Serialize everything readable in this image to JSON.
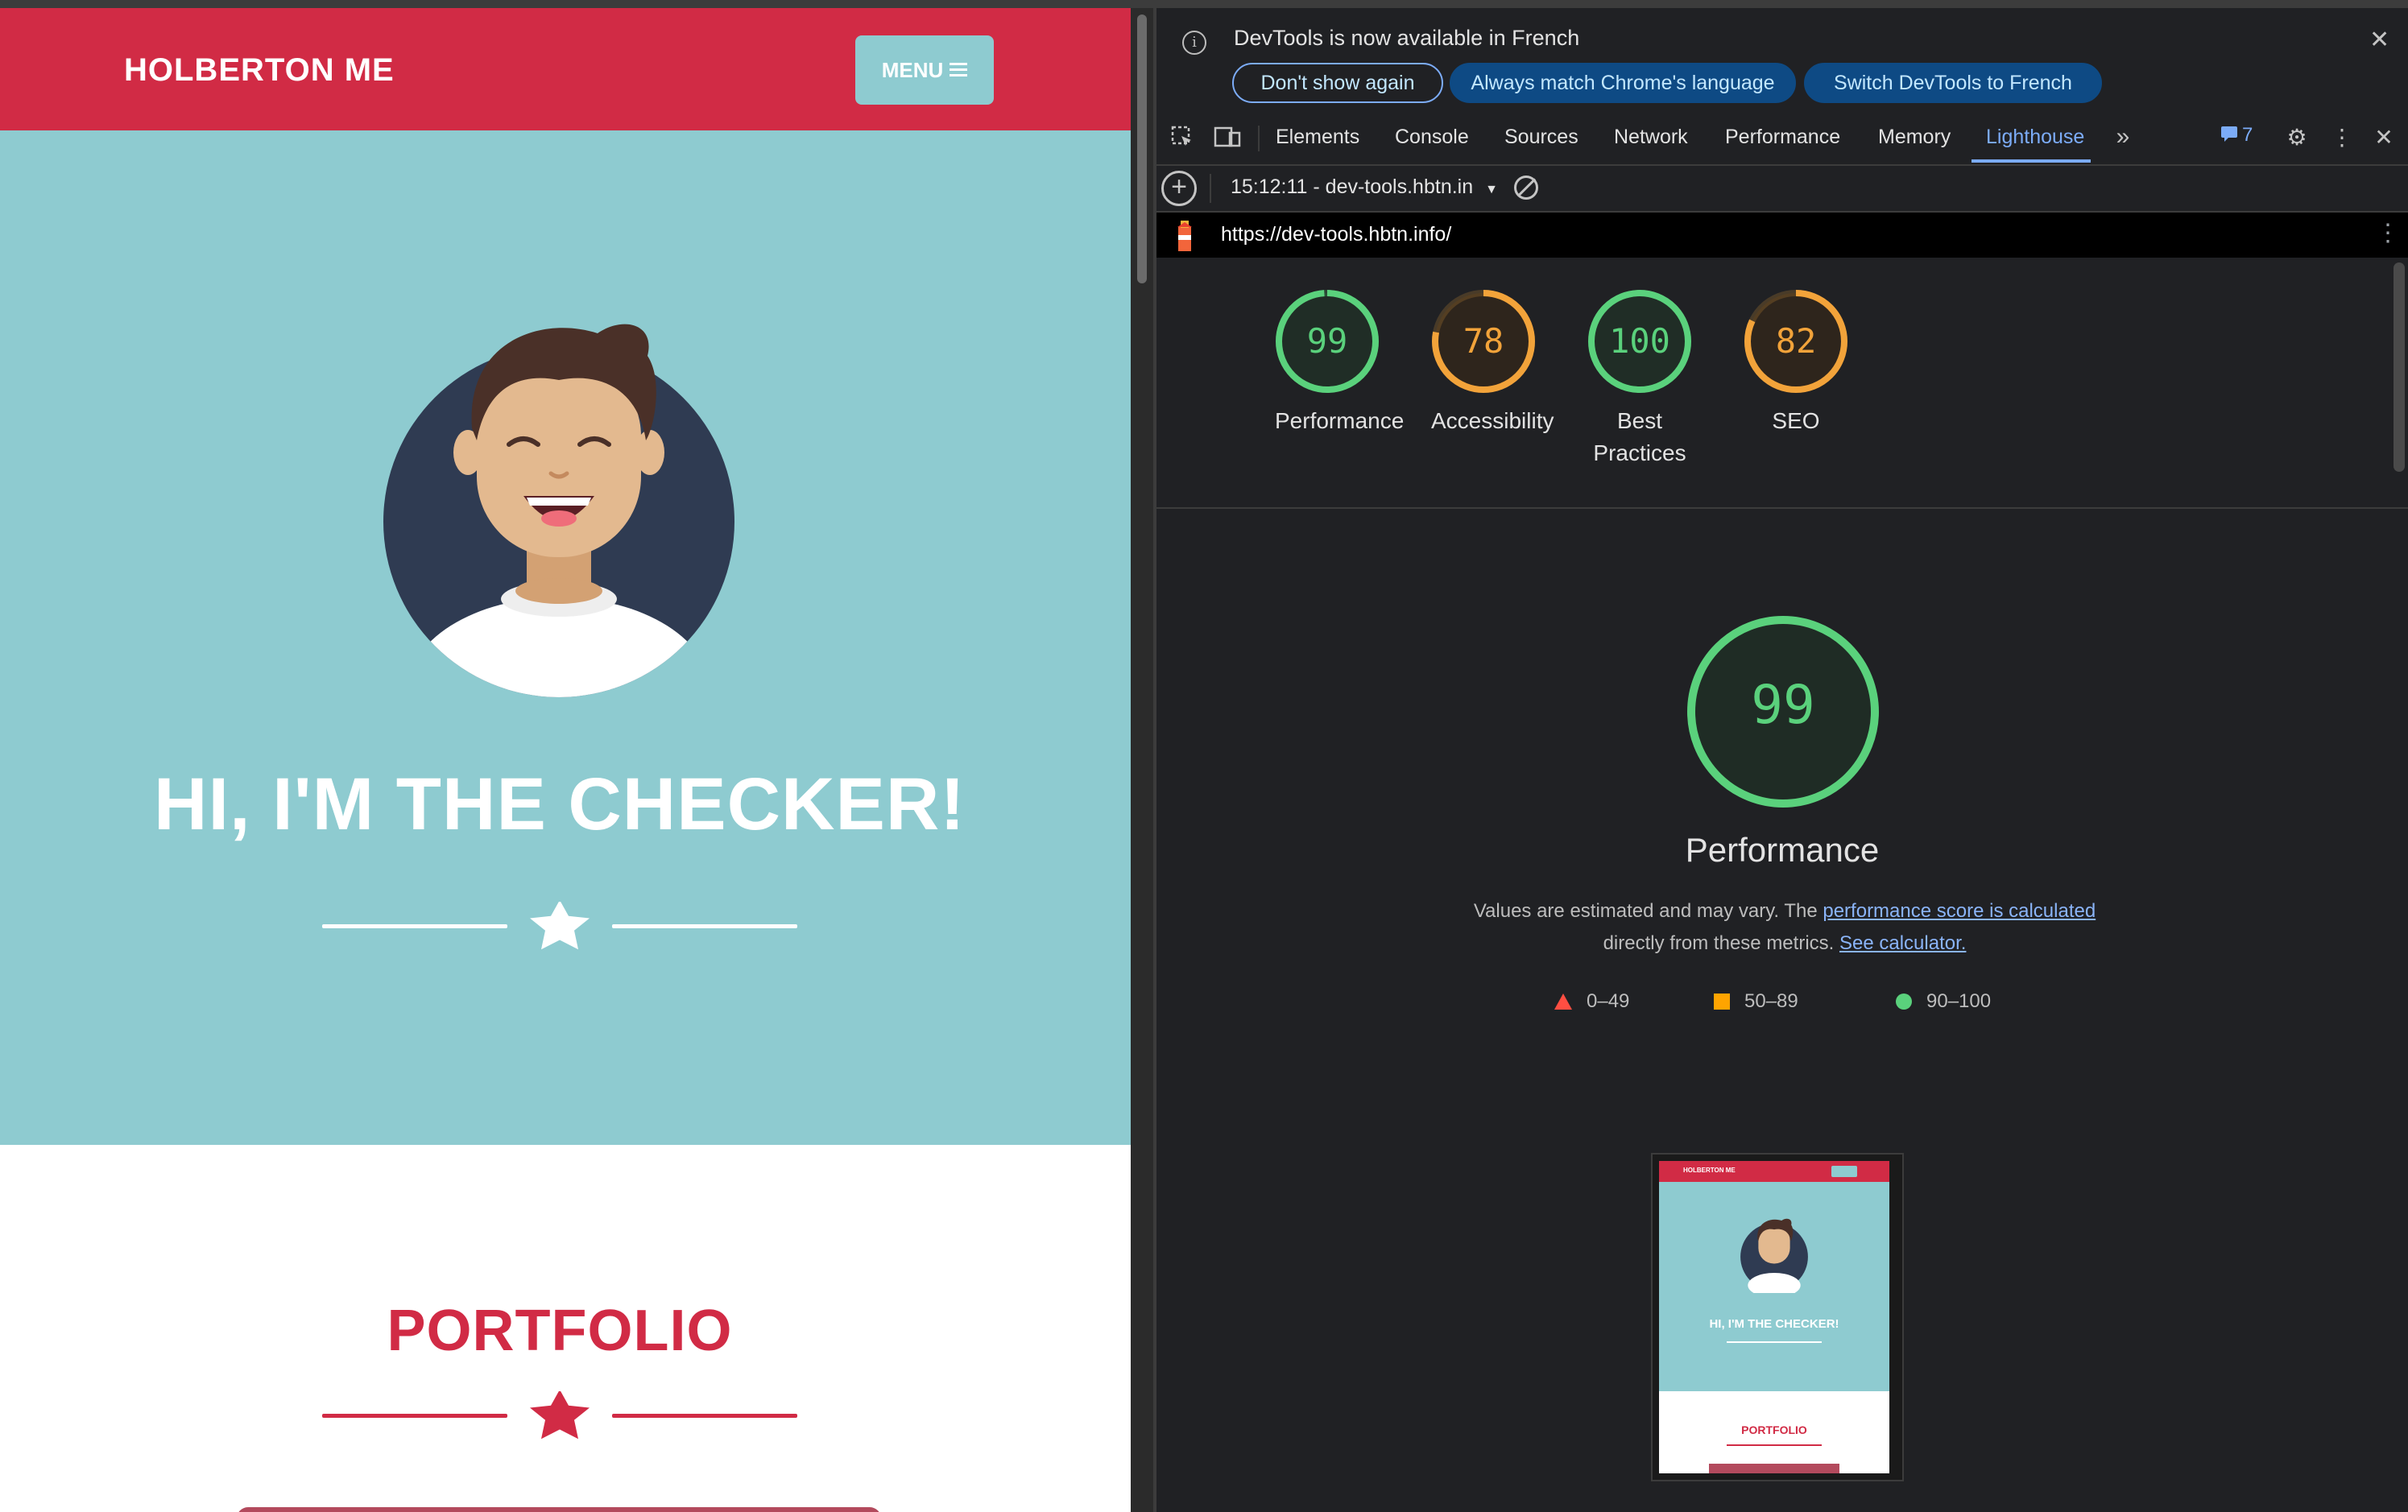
{
  "website": {
    "brand": "HOLBERTON ME",
    "menu_label": "MENU",
    "hero_title": "HI, I'M THE CHECKER!",
    "portfolio_title": "PORTFOLIO",
    "colors": {
      "red": "#d12b45",
      "teal": "#8ecbd0"
    }
  },
  "devtools": {
    "infobar": {
      "message": "DevTools is now available in French",
      "buttons": [
        "Don't show again",
        "Always match Chrome's language",
        "Switch DevTools to French"
      ]
    },
    "tabs": [
      "Elements",
      "Console",
      "Sources",
      "Network",
      "Performance",
      "Memory",
      "Lighthouse"
    ],
    "active_tab": "Lighthouse",
    "issues_count": "7",
    "report_select": "15:12:11 - dev-tools.hbtn.in",
    "url": "https://dev-tools.hbtn.info/",
    "scores": [
      {
        "label": "Performance",
        "value": "99",
        "color": "#5ad17c"
      },
      {
        "label": "Accessibility",
        "value": "78",
        "color": "#f2a33a"
      },
      {
        "label": "Best Practices",
        "value": "100",
        "color": "#5ad17c"
      },
      {
        "label": "SEO",
        "value": "82",
        "color": "#f2a33a"
      }
    ],
    "detail": {
      "score": "99",
      "title": "Performance",
      "desc_prefix": "Values are estimated and may vary. The ",
      "desc_link1": "performance score is calculated",
      "desc_mid": " directly from these metrics. ",
      "desc_link2": "See calculator.",
      "legend": [
        {
          "range": "0–49",
          "color": "#ff4e42"
        },
        {
          "range": "50–89",
          "color": "#ffa400"
        },
        {
          "range": "90–100",
          "color": "#5ad17c"
        }
      ]
    },
    "thumbnail": {
      "brand": "HOLBERTON ME",
      "hero_title": "HI, I'M THE CHECKER!",
      "portfolio_title": "PORTFOLIO"
    }
  }
}
